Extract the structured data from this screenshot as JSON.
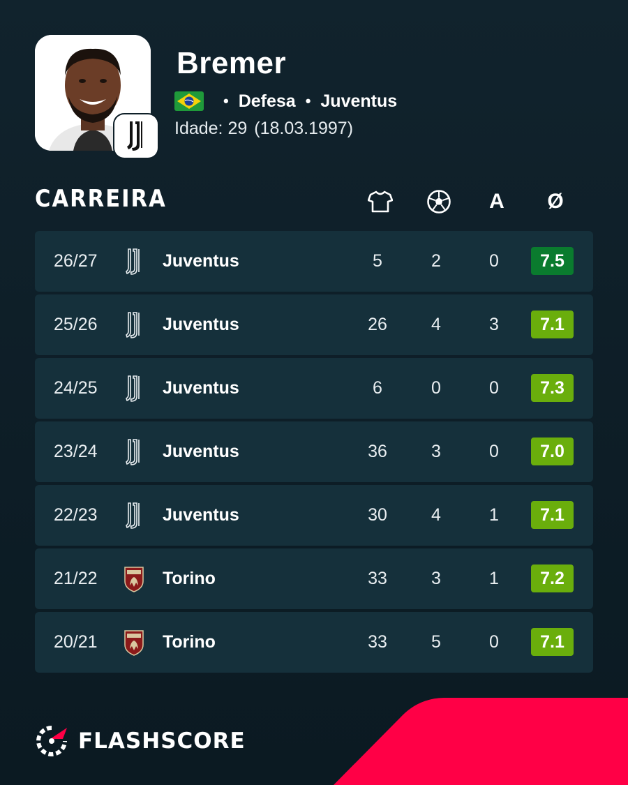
{
  "player": {
    "name": "Bremer",
    "nationality_flag": "brazil-flag",
    "position": "Defesa",
    "club": "Juventus",
    "age_label": "Idade: 29",
    "birth_date": "(18.03.1997)"
  },
  "career": {
    "title": "CARREIRA",
    "columns": [
      {
        "icon": "shirt-icon",
        "text": ""
      },
      {
        "icon": "football-icon",
        "text": ""
      },
      {
        "icon": "",
        "text": "A"
      },
      {
        "icon": "",
        "text": "Ø"
      }
    ],
    "rows": [
      {
        "season": "26/27",
        "team": "Juventus",
        "crest": "juventus-crest",
        "apps": "5",
        "goals": "2",
        "assists": "0",
        "rating": "7.5",
        "rating_color": "#0a7b2e"
      },
      {
        "season": "25/26",
        "team": "Juventus",
        "crest": "juventus-crest",
        "apps": "26",
        "goals": "4",
        "assists": "3",
        "rating": "7.1",
        "rating_color": "#6aae0c"
      },
      {
        "season": "24/25",
        "team": "Juventus",
        "crest": "juventus-crest",
        "apps": "6",
        "goals": "0",
        "assists": "0",
        "rating": "7.3",
        "rating_color": "#6aae0c"
      },
      {
        "season": "23/24",
        "team": "Juventus",
        "crest": "juventus-crest",
        "apps": "36",
        "goals": "3",
        "assists": "0",
        "rating": "7.0",
        "rating_color": "#6aae0c"
      },
      {
        "season": "22/23",
        "team": "Juventus",
        "crest": "juventus-crest",
        "apps": "30",
        "goals": "4",
        "assists": "1",
        "rating": "7.1",
        "rating_color": "#6aae0c"
      },
      {
        "season": "21/22",
        "team": "Torino",
        "crest": "torino-crest",
        "apps": "33",
        "goals": "3",
        "assists": "1",
        "rating": "7.2",
        "rating_color": "#6aae0c"
      },
      {
        "season": "20/21",
        "team": "Torino",
        "crest": "torino-crest",
        "apps": "33",
        "goals": "5",
        "assists": "0",
        "rating": "7.1",
        "rating_color": "#6aae0c"
      }
    ]
  },
  "brand": {
    "name": "FLASHSCORE",
    "accent_color": "#ff0046"
  }
}
